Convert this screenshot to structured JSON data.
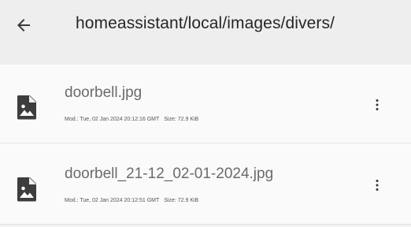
{
  "header": {
    "back_icon": "arrow-left-icon",
    "path": "homeassistant/local/images/divers/"
  },
  "files": [
    {
      "name": "doorbell.jpg",
      "icon": "image-file-icon",
      "modified": "Mod.: Tue, 02 Jan 2024 20:12:16 GMT",
      "size": "Size: 72.9 KiB",
      "menu_icon": "more-vertical-icon"
    },
    {
      "name": "doorbell_21-12_02-01-2024.jpg",
      "icon": "image-file-icon",
      "modified": "Mod.: Tue, 02 Jan 2024 20:12:51 GMT",
      "size": "Size: 72.9 KiB",
      "menu_icon": "more-vertical-icon"
    }
  ],
  "colors": {
    "header_bg": "#eeeeee",
    "list_bg": "#fafafa",
    "title_text": "#262626",
    "file_name_text": "#6b6b6b",
    "meta_text": "#555555",
    "icon": "#3d3d3d"
  }
}
